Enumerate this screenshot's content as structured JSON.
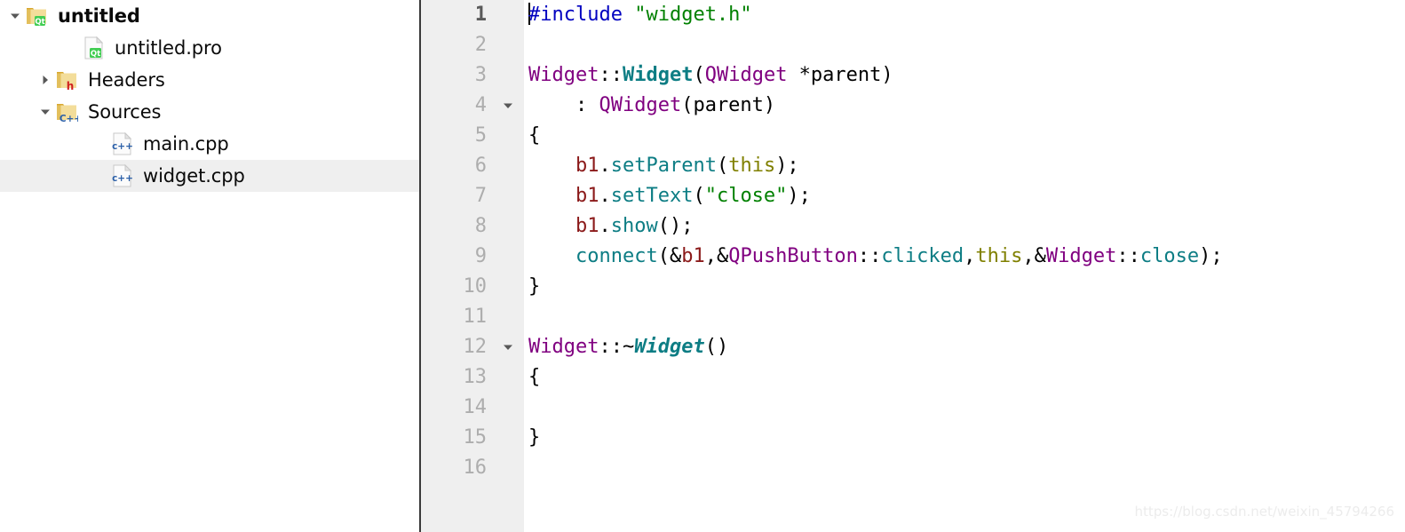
{
  "sidebar": {
    "name": "project-tree",
    "rows": [
      {
        "label": "untitled",
        "icon": "qt-folder-icon",
        "twisty": "chevron-down-icon",
        "indent": 8,
        "bold": true,
        "selected": false
      },
      {
        "label": "untitled.pro",
        "icon": "qt-file-icon",
        "twisty": "none",
        "indent": 72,
        "bold": false,
        "selected": false
      },
      {
        "label": "Headers",
        "icon": "h-folder-icon",
        "twisty": "chevron-right-icon",
        "indent": 42,
        "bold": false,
        "selected": false
      },
      {
        "label": "Sources",
        "icon": "cpp-folder-icon",
        "twisty": "chevron-down-icon",
        "indent": 42,
        "bold": false,
        "selected": false
      },
      {
        "label": "main.cpp",
        "icon": "cpp-file-icon",
        "twisty": "none",
        "indent": 104,
        "bold": false,
        "selected": false
      },
      {
        "label": "widget.cpp",
        "icon": "cpp-file-icon",
        "twisty": "none",
        "indent": 104,
        "bold": false,
        "selected": true
      }
    ]
  },
  "editor": {
    "name": "code-editor",
    "current_line": 1,
    "lines": [
      {
        "n": "1",
        "fold": "none",
        "caret": true,
        "tokens": [
          {
            "t": "#include ",
            "c": "tk-pre"
          },
          {
            "t": "\"widget.h\"",
            "c": "tk-str"
          }
        ]
      },
      {
        "n": "2",
        "fold": "none",
        "caret": false,
        "tokens": []
      },
      {
        "n": "3",
        "fold": "none",
        "caret": false,
        "tokens": [
          {
            "t": "Widget",
            "c": "tk-type"
          },
          {
            "t": "::",
            "c": "tk-punc"
          },
          {
            "t": "Widget",
            "c": "tk-decl"
          },
          {
            "t": "(",
            "c": "tk-punc"
          },
          {
            "t": "QWidget",
            "c": "tk-type"
          },
          {
            "t": " *parent)",
            "c": "tk-punc"
          }
        ]
      },
      {
        "n": "4",
        "fold": "chevron-down-icon",
        "caret": false,
        "tokens": [
          {
            "t": "    : ",
            "c": "tk-punc"
          },
          {
            "t": "QWidget",
            "c": "tk-type"
          },
          {
            "t": "(parent)",
            "c": "tk-punc"
          }
        ]
      },
      {
        "n": "5",
        "fold": "none",
        "caret": false,
        "tokens": [
          {
            "t": "{",
            "c": "tk-punc"
          }
        ]
      },
      {
        "n": "6",
        "fold": "none",
        "caret": false,
        "tokens": [
          {
            "t": "    ",
            "c": "tk-punc"
          },
          {
            "t": "b1",
            "c": "tk-member"
          },
          {
            "t": ".",
            "c": "tk-punc"
          },
          {
            "t": "setParent",
            "c": "tk-func"
          },
          {
            "t": "(",
            "c": "tk-punc"
          },
          {
            "t": "this",
            "c": "tk-kw"
          },
          {
            "t": ");",
            "c": "tk-punc"
          }
        ]
      },
      {
        "n": "7",
        "fold": "none",
        "caret": false,
        "tokens": [
          {
            "t": "    ",
            "c": "tk-punc"
          },
          {
            "t": "b1",
            "c": "tk-member"
          },
          {
            "t": ".",
            "c": "tk-punc"
          },
          {
            "t": "setText",
            "c": "tk-func"
          },
          {
            "t": "(",
            "c": "tk-punc"
          },
          {
            "t": "\"close\"",
            "c": "tk-str"
          },
          {
            "t": ");",
            "c": "tk-punc"
          }
        ]
      },
      {
        "n": "8",
        "fold": "none",
        "caret": false,
        "tokens": [
          {
            "t": "    ",
            "c": "tk-punc"
          },
          {
            "t": "b1",
            "c": "tk-member"
          },
          {
            "t": ".",
            "c": "tk-punc"
          },
          {
            "t": "show",
            "c": "tk-func"
          },
          {
            "t": "();",
            "c": "tk-punc"
          }
        ]
      },
      {
        "n": "9",
        "fold": "none",
        "caret": false,
        "tokens": [
          {
            "t": "    ",
            "c": "tk-punc"
          },
          {
            "t": "connect",
            "c": "tk-func"
          },
          {
            "t": "(&",
            "c": "tk-punc"
          },
          {
            "t": "b1",
            "c": "tk-member"
          },
          {
            "t": ",&",
            "c": "tk-punc"
          },
          {
            "t": "QPushButton",
            "c": "tk-type"
          },
          {
            "t": "::",
            "c": "tk-punc"
          },
          {
            "t": "clicked",
            "c": "tk-func"
          },
          {
            "t": ",",
            "c": "tk-punc"
          },
          {
            "t": "this",
            "c": "tk-kw"
          },
          {
            "t": ",&",
            "c": "tk-punc"
          },
          {
            "t": "Widget",
            "c": "tk-type"
          },
          {
            "t": "::",
            "c": "tk-punc"
          },
          {
            "t": "close",
            "c": "tk-func"
          },
          {
            "t": ");",
            "c": "tk-punc"
          }
        ]
      },
      {
        "n": "10",
        "fold": "none",
        "caret": false,
        "tokens": [
          {
            "t": "}",
            "c": "tk-punc"
          }
        ]
      },
      {
        "n": "11",
        "fold": "none",
        "caret": false,
        "tokens": []
      },
      {
        "n": "12",
        "fold": "chevron-down-icon",
        "caret": false,
        "tokens": [
          {
            "t": "Widget",
            "c": "tk-type"
          },
          {
            "t": "::~",
            "c": "tk-punc"
          },
          {
            "t": "Widget",
            "c": "tk-dtor"
          },
          {
            "t": "()",
            "c": "tk-punc"
          }
        ]
      },
      {
        "n": "13",
        "fold": "none",
        "caret": false,
        "tokens": [
          {
            "t": "{",
            "c": "tk-punc"
          }
        ]
      },
      {
        "n": "14",
        "fold": "none",
        "caret": false,
        "tokens": []
      },
      {
        "n": "15",
        "fold": "none",
        "caret": false,
        "tokens": [
          {
            "t": "}",
            "c": "tk-punc"
          }
        ]
      },
      {
        "n": "16",
        "fold": "none",
        "caret": false,
        "tokens": []
      }
    ]
  },
  "watermark": {
    "text": "https://blog.csdn.net/weixin_45794266"
  },
  "colors": {
    "gutter_bg": "#efefef",
    "selection_bg": "#efefef",
    "preprocessor": "#0000c0",
    "string": "#008000",
    "type": "#800080",
    "function": "#0d7d84",
    "member": "#8b1a1a",
    "keyword": "#808000",
    "lineno": "#adadad",
    "divider": "#3a3a3a"
  }
}
